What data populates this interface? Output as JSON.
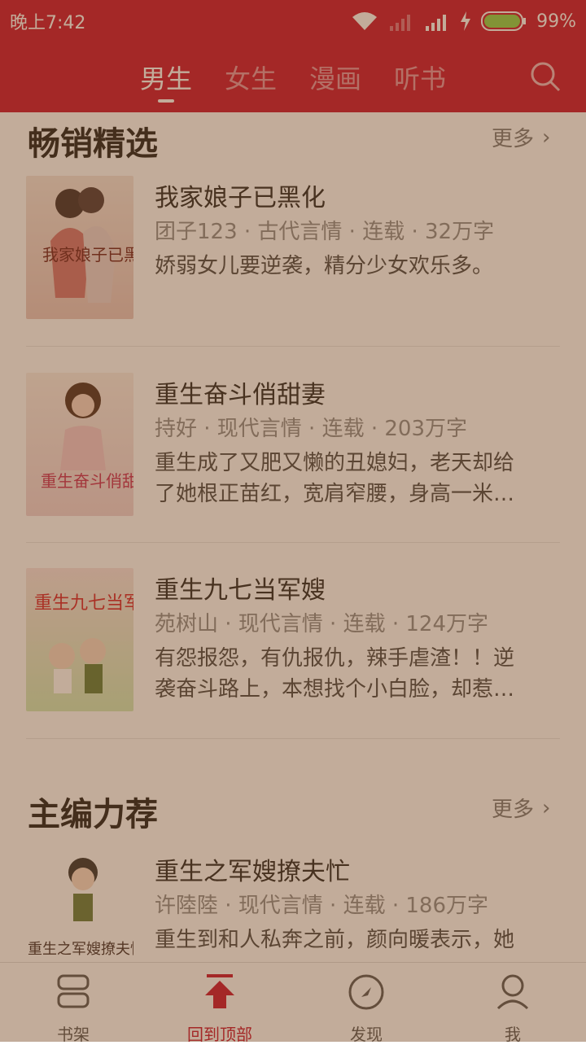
{
  "status_bar": {
    "time": "晚上7:42",
    "battery": "99%"
  },
  "top_nav": {
    "tabs": [
      {
        "label": "男生",
        "active": true
      },
      {
        "label": "女生",
        "active": false
      },
      {
        "label": "漫画",
        "active": false
      },
      {
        "label": "听书",
        "active": false
      }
    ]
  },
  "sections": [
    {
      "title": "畅销精选",
      "more": "更多",
      "books": [
        {
          "title": "我家娘子已黑化",
          "meta": "团子123 · 古代言情 · 连载 · 32万字",
          "desc": [
            "娇弱女儿要逆袭，精分少女欢乐多。"
          ]
        },
        {
          "title": "重生奋斗俏甜妻",
          "meta": "持好 · 现代言情 · 连载 · 203万字",
          "desc": [
            "重生成了又肥又懒的丑媳妇，老天却给",
            "了她根正苗红，宽肩窄腰，身高一米…"
          ]
        },
        {
          "title": "重生九七当军嫂",
          "meta": "苑树山 · 现代言情 · 连载 · 124万字",
          "desc": [
            "有怨报怨，有仇报仇，辣手虐渣！！逆",
            "袭奋斗路上，本想找个小白脸，却惹…"
          ]
        }
      ]
    },
    {
      "title": "主编力荐",
      "more": "更多",
      "books": [
        {
          "title": "重生之军嫂撩夫忙",
          "meta": "许陸陸 · 现代言情 · 连载 · 186万字",
          "desc": [
            "重生到和人私奔之前，颜向暖表示，她"
          ]
        }
      ]
    }
  ],
  "covers": {
    "cover1_text": "我家娘子已黑化",
    "cover2_text": "重生奋斗俏甜妻",
    "cover3_text": "重生九七当军嫂",
    "cover4_text": "重生之军嫂撩夫忙"
  },
  "bottom_nav": {
    "items": [
      {
        "label": "书架",
        "icon": "bookshelf-icon"
      },
      {
        "label": "回到顶部",
        "icon": "back-to-top-icon",
        "active": true
      },
      {
        "label": "发现",
        "icon": "compass-icon"
      },
      {
        "label": "我",
        "icon": "user-icon"
      }
    ]
  },
  "colors": {
    "brand": "#c8102e",
    "overlay": "#78461e"
  }
}
